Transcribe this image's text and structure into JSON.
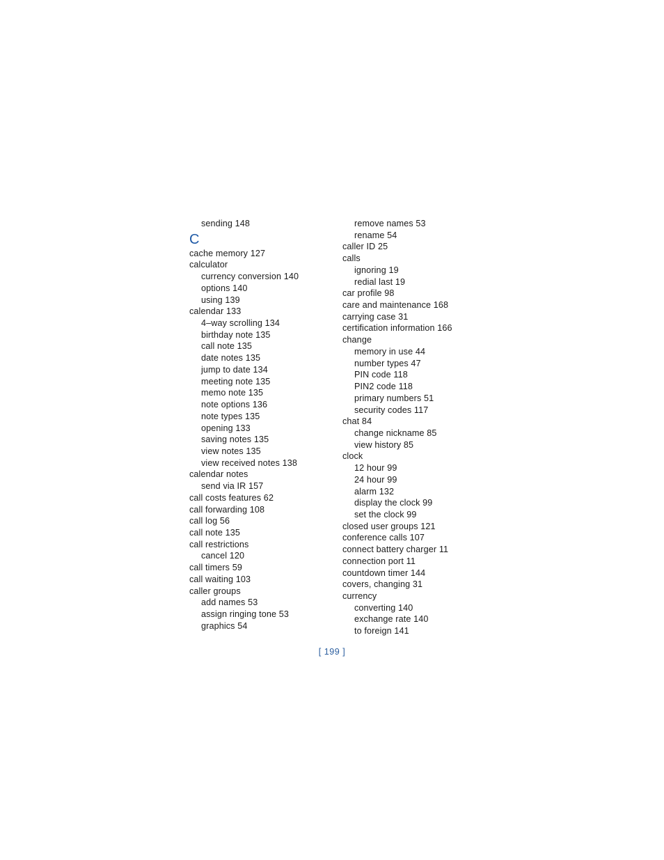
{
  "document": {
    "type": "book-index",
    "page_label": "[ 199 ]",
    "accent_color": "#1f5aa6",
    "page_number_color": "#2a5d9e",
    "text_color": "#1a1a1a",
    "background_color": "#ffffff"
  },
  "columns": {
    "left": {
      "blocks": [
        {
          "kind": "entries",
          "entries": [
            {
              "level": 1,
              "text": "sending 148"
            }
          ]
        },
        {
          "kind": "letter-heading",
          "letter": "C"
        },
        {
          "kind": "entries",
          "entries": [
            {
              "level": 0,
              "text": "cache memory 127"
            },
            {
              "level": 0,
              "text": "calculator"
            },
            {
              "level": 1,
              "text": "currency conversion 140"
            },
            {
              "level": 1,
              "text": "options 140"
            },
            {
              "level": 1,
              "text": "using 139"
            },
            {
              "level": 0,
              "text": "calendar 133"
            },
            {
              "level": 1,
              "text": "4–way scrolling 134"
            },
            {
              "level": 1,
              "text": "birthday note 135"
            },
            {
              "level": 1,
              "text": "call note 135"
            },
            {
              "level": 1,
              "text": "date notes 135"
            },
            {
              "level": 1,
              "text": "jump to date 134"
            },
            {
              "level": 1,
              "text": "meeting note 135"
            },
            {
              "level": 1,
              "text": "memo note 135"
            },
            {
              "level": 1,
              "text": "note options 136"
            },
            {
              "level": 1,
              "text": "note types 135"
            },
            {
              "level": 1,
              "text": "opening 133"
            },
            {
              "level": 1,
              "text": "saving notes 135"
            },
            {
              "level": 1,
              "text": "view notes 135"
            },
            {
              "level": 1,
              "text": "view received notes 138"
            },
            {
              "level": 0,
              "text": "calendar notes"
            },
            {
              "level": 1,
              "text": "send via IR 157"
            },
            {
              "level": 0,
              "text": "call costs features 62"
            },
            {
              "level": 0,
              "text": "call forwarding 108"
            },
            {
              "level": 0,
              "text": "call log 56"
            },
            {
              "level": 0,
              "text": "call note 135"
            },
            {
              "level": 0,
              "text": "call restrictions"
            },
            {
              "level": 1,
              "text": "cancel 120"
            },
            {
              "level": 0,
              "text": "call timers 59"
            },
            {
              "level": 0,
              "text": "call waiting 103"
            },
            {
              "level": 0,
              "text": "caller groups"
            },
            {
              "level": 1,
              "text": "add names 53"
            },
            {
              "level": 1,
              "text": "assign ringing tone 53"
            },
            {
              "level": 1,
              "text": "graphics 54"
            }
          ]
        }
      ]
    },
    "right": {
      "blocks": [
        {
          "kind": "entries",
          "entries": [
            {
              "level": 1,
              "text": "remove names 53"
            },
            {
              "level": 1,
              "text": "rename 54"
            },
            {
              "level": 0,
              "text": "caller ID 25"
            },
            {
              "level": 0,
              "text": "calls"
            },
            {
              "level": 1,
              "text": "ignoring 19"
            },
            {
              "level": 1,
              "text": "redial last 19"
            },
            {
              "level": 0,
              "text": "car profile 98"
            },
            {
              "level": 0,
              "text": "care and maintenance 168"
            },
            {
              "level": 0,
              "text": "carrying case 31"
            },
            {
              "level": 0,
              "text": "certification information 166"
            },
            {
              "level": 0,
              "text": "change"
            },
            {
              "level": 1,
              "text": "memory in use 44"
            },
            {
              "level": 1,
              "text": "number types 47"
            },
            {
              "level": 1,
              "text": "PIN code 118"
            },
            {
              "level": 1,
              "text": "PIN2 code 118"
            },
            {
              "level": 1,
              "text": "primary numbers 51"
            },
            {
              "level": 1,
              "text": "security codes 117"
            },
            {
              "level": 0,
              "text": "chat 84"
            },
            {
              "level": 1,
              "text": "change nickname 85"
            },
            {
              "level": 1,
              "text": "view history 85"
            },
            {
              "level": 0,
              "text": "clock"
            },
            {
              "level": 1,
              "text": "12 hour 99"
            },
            {
              "level": 1,
              "text": "24 hour 99"
            },
            {
              "level": 1,
              "text": "alarm 132"
            },
            {
              "level": 1,
              "text": "display the clock 99"
            },
            {
              "level": 1,
              "text": "set the clock 99"
            },
            {
              "level": 0,
              "text": "closed user groups 121"
            },
            {
              "level": 0,
              "text": "conference calls 107"
            },
            {
              "level": 0,
              "text": "connect battery charger 11"
            },
            {
              "level": 0,
              "text": "connection port 11"
            },
            {
              "level": 0,
              "text": "countdown timer 144"
            },
            {
              "level": 0,
              "text": "covers, changing 31"
            },
            {
              "level": 0,
              "text": "currency"
            },
            {
              "level": 1,
              "text": "converting 140"
            },
            {
              "level": 1,
              "text": "exchange rate 140"
            },
            {
              "level": 1,
              "text": "to foreign 141"
            }
          ]
        }
      ]
    }
  }
}
